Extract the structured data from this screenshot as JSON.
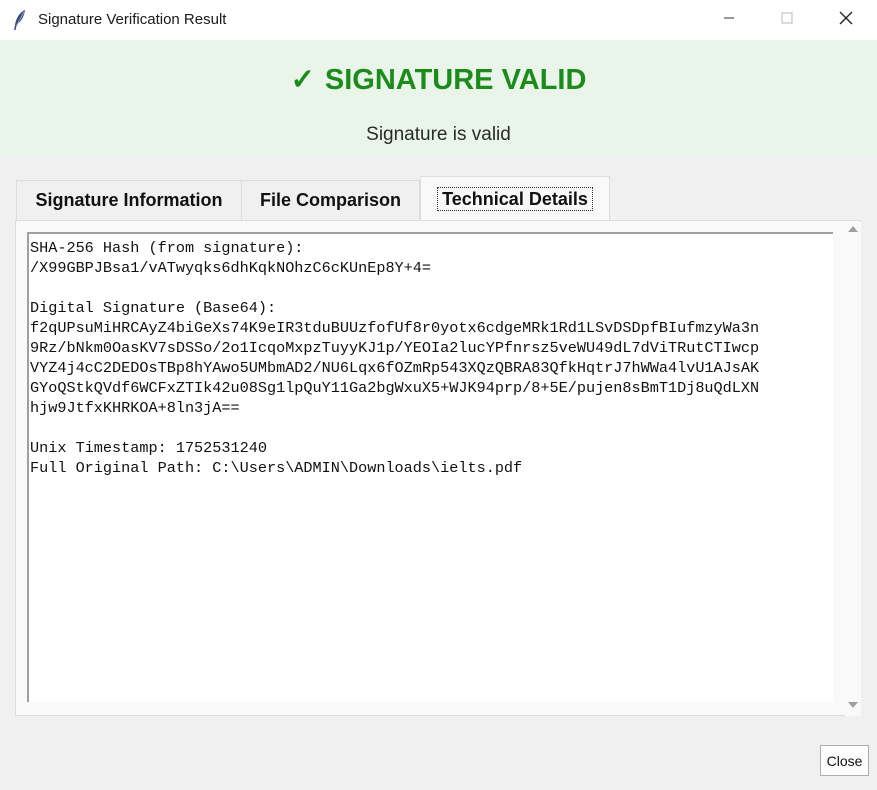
{
  "window": {
    "title": "Signature Verification Result"
  },
  "status": {
    "check_symbol": "✓",
    "title": "SIGNATURE VALID",
    "message": "Signature is valid",
    "color": "#1e8a1e",
    "background": "#e8f5e8"
  },
  "tabs": [
    {
      "label": "Signature Information",
      "selected": false
    },
    {
      "label": "File Comparison",
      "selected": false
    },
    {
      "label": "Technical Details",
      "selected": true
    }
  ],
  "technical_details": {
    "lines": [
      "SHA-256 Hash (from signature):",
      "/X99GBPJBsa1/vATwyqks6dhKqkNOhzC6cKUnEp8Y+4=",
      "",
      "Digital Signature (Base64):",
      "f2qUPsuMiHRCAyZ4biGeXs74K9eIR3tduBUUzfofUf8r0yotx6cdgeMRk1Rd1LSvDSDpfBIufmzyWa3n",
      "9Rz/bNkm0OasKV7sDSSo/2o1IcqoMxpzTuyyKJ1p/YEOIa2lucYPfnrsz5veWU49dL7dViTRutCTIwcp",
      "VYZ4j4cC2DEDOsTBp8hYAwo5UMbmAD2/NU6Lqx6fOZmRp543XQzQBRA83QfkHqtrJ7hWWa4lvU1AJsAK",
      "GYoQStkQVdf6WCFxZTIk42u08Sg1lpQuY11Ga2bgWxuX5+WJK94prp/8+5E/pujen8sBmT1Dj8uQdLXN",
      "hjw9JtfxKHRKOA+8ln3jA==",
      "",
      "Unix Timestamp: 1752531240",
      "Full Original Path: C:\\Users\\ADMIN\\Downloads\\ielts.pdf"
    ]
  },
  "buttons": {
    "close_label": "Close"
  },
  "icons": {
    "app": "feather-icon",
    "minimize": "minimize-icon",
    "maximize": "maximize-icon",
    "close": "close-icon"
  }
}
